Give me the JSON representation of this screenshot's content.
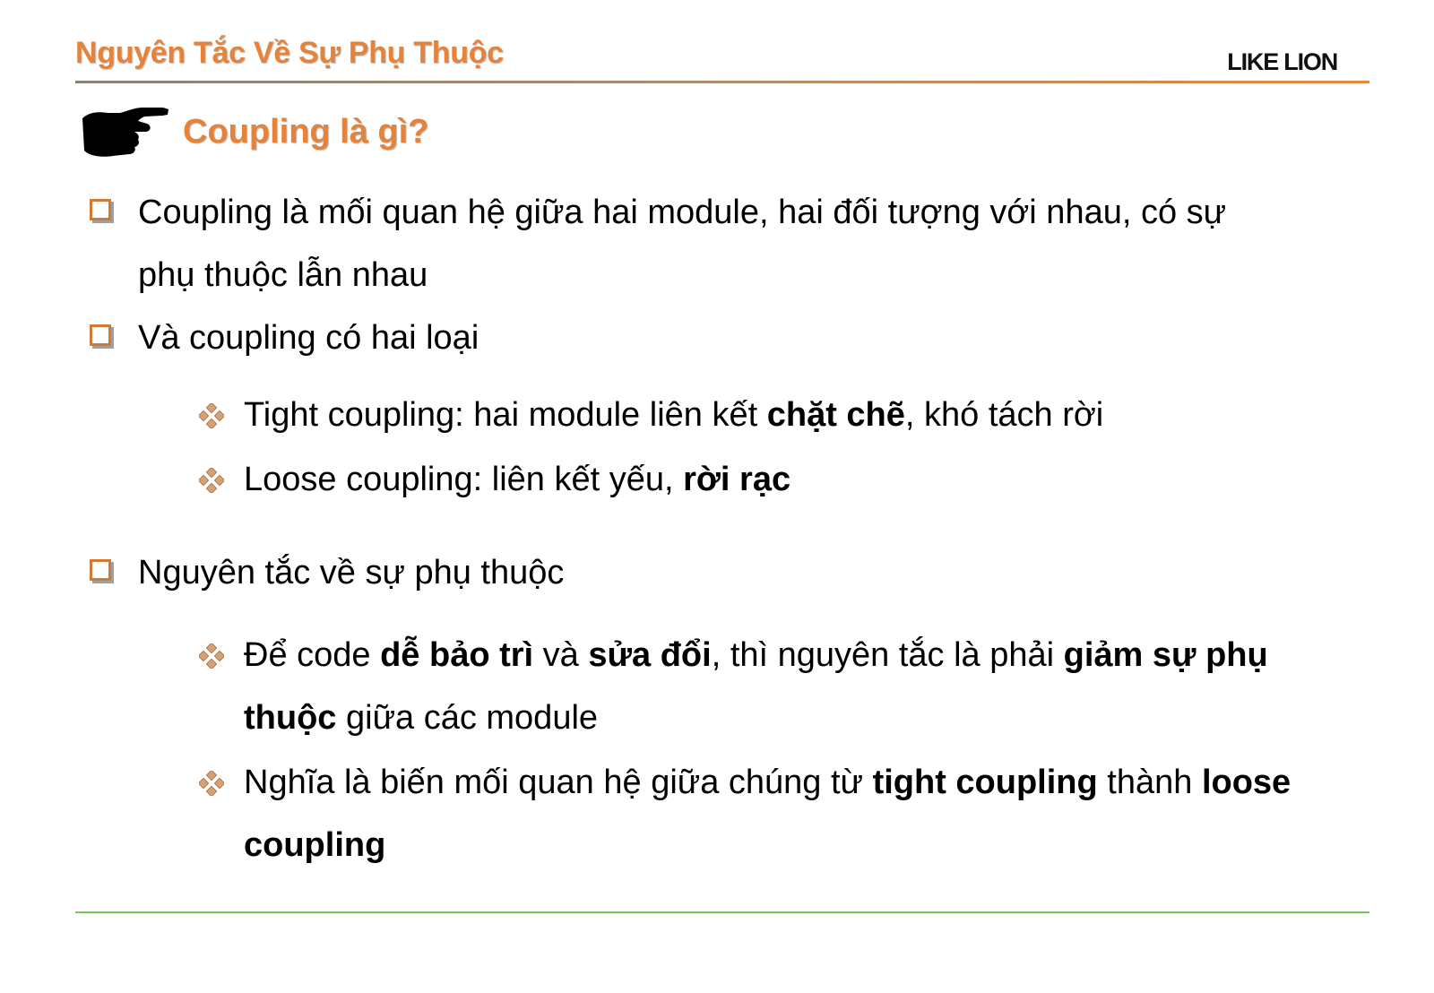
{
  "header": {
    "title": "Nguyên Tắc Về Sự Phụ Thuộc",
    "brand": "LIKE LION"
  },
  "section": {
    "title": "Coupling là gì?",
    "icon": "pointing-hand-icon"
  },
  "colors": {
    "accent": "#e5833a",
    "footer_rule": "#7cc35a"
  },
  "bullets": {
    "b1": {
      "line1": "Coupling là mối quan hệ giữa hai module, hai đối tượng với nhau, có sự",
      "line2": "phụ thuộc lẫn nhau"
    },
    "b2": {
      "text": "Và coupling có hai loại",
      "subs": [
        {
          "pre": "Tight coupling: hai module liên kết ",
          "bold": "chặt chẽ",
          "post": ", khó tách rời"
        },
        {
          "pre": "Loose coupling: liên kết yếu, ",
          "bold": "rời rạc"
        }
      ]
    },
    "b3": {
      "text": "Nguyên tắc về sự phụ thuộc",
      "sub1": {
        "t1": "Để code ",
        "b1": "dễ bảo trì",
        "t2": " và ",
        "b2": "sửa đổi",
        "t3": ", thì nguyên tắc là phải ",
        "b3": "giảm sự phụ",
        "b4": "thuộc",
        "t4": " giữa các module"
      },
      "sub2": {
        "t1": "Nghĩa là biến mối quan hệ giữa chúng từ ",
        "b1": "tight coupling",
        "t2": " thành ",
        "b2": "loose",
        "b3": "coupling"
      }
    }
  }
}
